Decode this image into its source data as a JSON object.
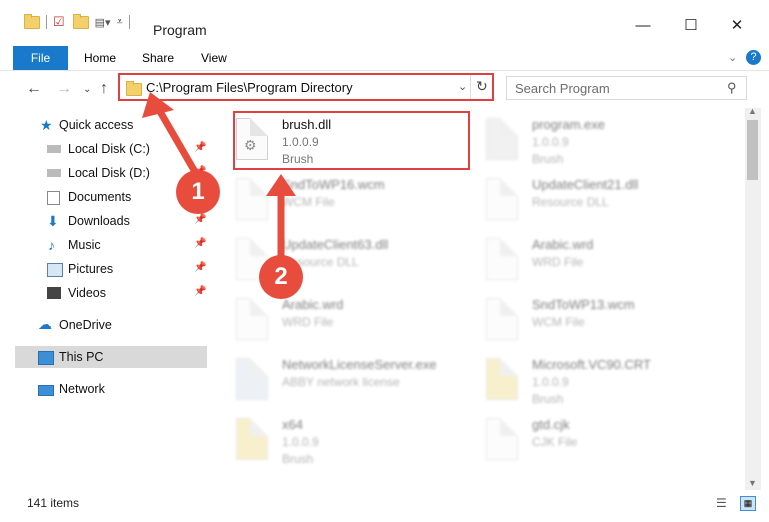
{
  "window": {
    "title": "Program",
    "minimize": "—",
    "maximize": "☐",
    "close": "✕",
    "help": "?"
  },
  "ribbon": {
    "file": "File",
    "home": "Home",
    "share": "Share",
    "view": "View"
  },
  "address": {
    "path": "C:\\Program Files\\Program Directory",
    "search_placeholder": "Search Program"
  },
  "nav": {
    "quick_access": "Quick access",
    "items": [
      "Local Disk (C:)",
      "Local Disk (D:)",
      "Documents",
      "Downloads",
      "Music",
      "Pictures",
      "Videos"
    ],
    "onedrive": "OneDrive",
    "this_pc": "This PC",
    "network": "Network"
  },
  "files": [
    {
      "name": "brush.dll",
      "line2": "1.0.0.9",
      "line3": "Brush"
    },
    {
      "name": "program.exe",
      "line2": "1.0.0.9",
      "line3": "Brush"
    },
    {
      "name": "SndToWP16.wcm",
      "line2": "WCM File",
      "line3": ""
    },
    {
      "name": "UpdateClient21.dll",
      "line2": "Resource DLL",
      "line3": ""
    },
    {
      "name": "UpdateClient63.dll",
      "line2": "Resource DLL",
      "line3": ""
    },
    {
      "name": "Arabic.wrd",
      "line2": "WRD File",
      "line3": ""
    },
    {
      "name": "Arabic.wrd",
      "line2": "WRD File",
      "line3": ""
    },
    {
      "name": "SndToWP13.wcm",
      "line2": "WCM File",
      "line3": ""
    },
    {
      "name": "NetworkLicenseServer.exe",
      "line2": "ABBY network license",
      "line3": ""
    },
    {
      "name": "Microsoft.VC90.CRT",
      "line2": "1.0.0.9",
      "line3": "Brush"
    },
    {
      "name": "x64",
      "line2": "1.0.0.9",
      "line3": "Brush"
    },
    {
      "name": "gtd.cjk",
      "line2": "CJK File",
      "line3": ""
    }
  ],
  "status": {
    "count": "141 items"
  },
  "callouts": [
    "1",
    "2"
  ],
  "colors": {
    "accent": "#1979ca",
    "highlight": "#e04040",
    "callout": "#e74c3c"
  }
}
